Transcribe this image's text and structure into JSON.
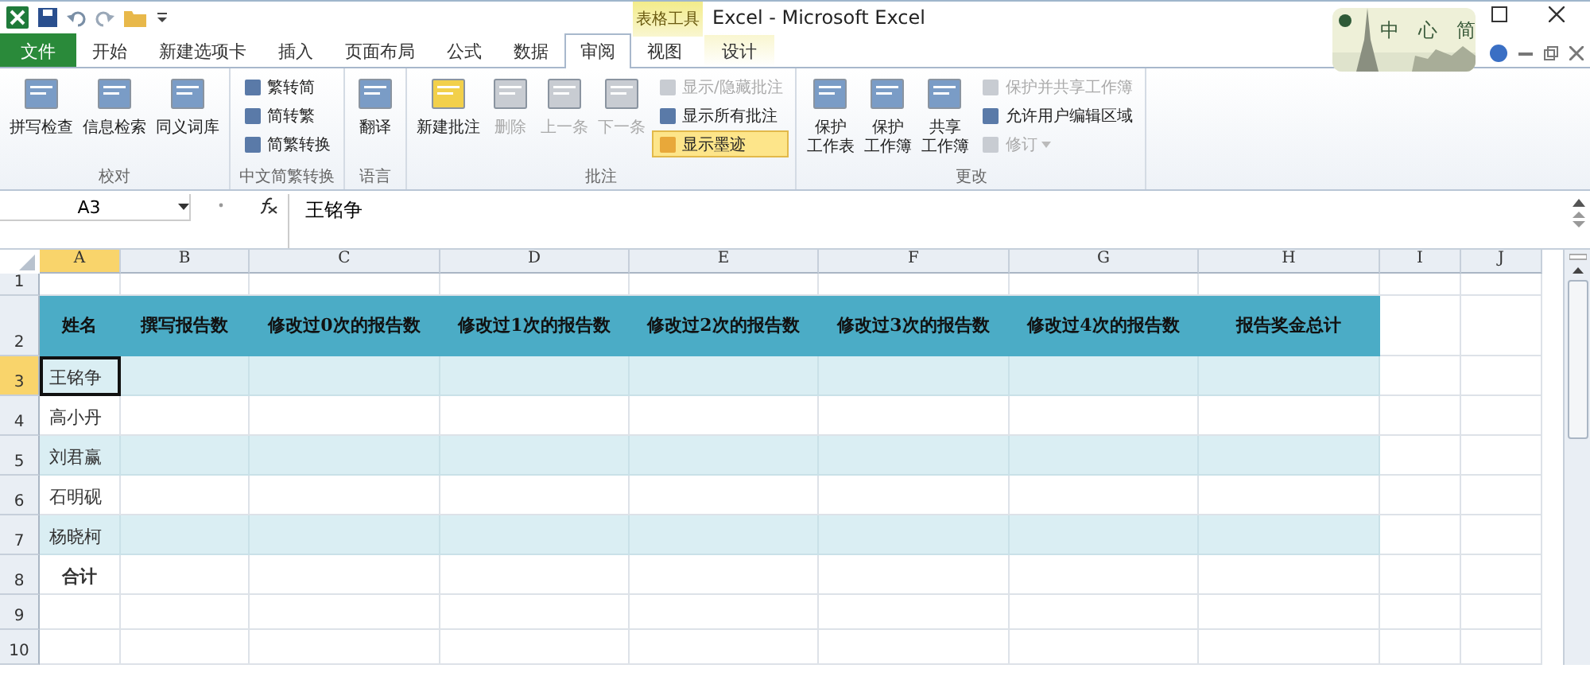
{
  "window": {
    "title": "Excel - Microsoft Excel",
    "contextual_group": "表格工具"
  },
  "tabs": [
    {
      "label": "文件",
      "kind": "file",
      "selected": false
    },
    {
      "label": "开始",
      "kind": "tab",
      "selected": false
    },
    {
      "label": "新建选项卡",
      "kind": "tab",
      "selected": false
    },
    {
      "label": "插入",
      "kind": "tab",
      "selected": false
    },
    {
      "label": "页面布局",
      "kind": "tab",
      "selected": false
    },
    {
      "label": "公式",
      "kind": "tab",
      "selected": false
    },
    {
      "label": "数据",
      "kind": "tab",
      "selected": false
    },
    {
      "label": "审阅",
      "kind": "tab",
      "selected": true
    },
    {
      "label": "视图",
      "kind": "tab",
      "selected": false
    },
    {
      "label": "设计",
      "kind": "contextual",
      "selected": false
    }
  ],
  "ime_bar": {
    "labels": [
      "中",
      "心",
      "简"
    ]
  },
  "ribbon_groups": [
    {
      "label": "校对",
      "items": [
        {
          "label": "拼写检查",
          "kind": "large",
          "disabled": false,
          "on": false
        },
        {
          "label": "信息检索",
          "kind": "large",
          "disabled": false,
          "on": false
        },
        {
          "label": "同义词库",
          "kind": "large",
          "disabled": false,
          "on": false
        }
      ]
    },
    {
      "label": "中文简繁转换",
      "items": [
        {
          "label": "繁转简",
          "kind": "small",
          "disabled": false,
          "on": false
        },
        {
          "label": "简转繁",
          "kind": "small",
          "disabled": false,
          "on": false
        },
        {
          "label": "简繁转换",
          "kind": "small",
          "disabled": false,
          "on": false
        }
      ]
    },
    {
      "label": "语言",
      "items": [
        {
          "label": "翻译",
          "kind": "large",
          "disabled": false,
          "on": false
        }
      ]
    },
    {
      "label": "批注",
      "items": [
        {
          "label": "新建批注",
          "kind": "large",
          "disabled": false,
          "on": false
        },
        {
          "label": "删除",
          "kind": "large",
          "disabled": true,
          "on": false
        },
        {
          "label": "上一条",
          "kind": "large",
          "disabled": true,
          "on": false
        },
        {
          "label": "下一条",
          "kind": "large",
          "disabled": true,
          "on": false
        },
        {
          "label": "显示/隐藏批注",
          "kind": "small",
          "disabled": true,
          "on": false
        },
        {
          "label": "显示所有批注",
          "kind": "small",
          "disabled": false,
          "on": false
        },
        {
          "label": "显示墨迹",
          "kind": "small",
          "disabled": false,
          "on": true
        }
      ]
    },
    {
      "label": "更改",
      "items": [
        {
          "label_lines": [
            "保护",
            "工作表"
          ],
          "kind": "large",
          "disabled": false,
          "on": false
        },
        {
          "label_lines": [
            "保护",
            "工作簿"
          ],
          "kind": "large",
          "disabled": false,
          "on": false
        },
        {
          "label_lines": [
            "共享",
            "工作簿"
          ],
          "kind": "large",
          "disabled": false,
          "on": false
        },
        {
          "label": "保护并共享工作簿",
          "kind": "small",
          "disabled": true,
          "on": false
        },
        {
          "label": "允许用户编辑区域",
          "kind": "small",
          "disabled": false,
          "on": false
        },
        {
          "label": "修订",
          "kind": "dropdown",
          "disabled": true,
          "on": false
        }
      ]
    }
  ],
  "formula_bar": {
    "name_box": "A3",
    "formula": "王铭争"
  },
  "sheet": {
    "columns": [
      {
        "label": "A",
        "selected": true
      },
      {
        "label": "B",
        "selected": false
      },
      {
        "label": "C",
        "selected": false
      },
      {
        "label": "D",
        "selected": false
      },
      {
        "label": "E",
        "selected": false
      },
      {
        "label": "F",
        "selected": false
      },
      {
        "label": "G",
        "selected": false
      },
      {
        "label": "H",
        "selected": false
      },
      {
        "label": "I",
        "selected": false
      },
      {
        "label": "J",
        "selected": false
      }
    ],
    "rows": [
      {
        "number": "1",
        "kind": "blank",
        "selected": false
      },
      {
        "number": "2",
        "kind": "header",
        "selected": false,
        "cells": [
          "姓名",
          "撰写报告数",
          "修改过0次的报告数",
          "修改过1次的报告数",
          "修改过2次的报告数",
          "修改过3次的报告数",
          "修改过4次的报告数",
          "报告奖金总计"
        ]
      },
      {
        "number": "3",
        "kind": "band",
        "selected": true,
        "cells": [
          "王铭争"
        ]
      },
      {
        "number": "4",
        "kind": "plain",
        "selected": false,
        "cells": [
          "高小丹"
        ]
      },
      {
        "number": "5",
        "kind": "band",
        "selected": false,
        "cells": [
          "刘君赢"
        ]
      },
      {
        "number": "6",
        "kind": "plain",
        "selected": false,
        "cells": [
          "石明砚"
        ]
      },
      {
        "number": "7",
        "kind": "band",
        "selected": false,
        "cells": [
          "杨晓柯"
        ]
      },
      {
        "number": "8",
        "kind": "total",
        "selected": false,
        "cells": [
          "合计"
        ]
      },
      {
        "number": "9",
        "kind": "blank",
        "selected": false
      },
      {
        "number": "10",
        "kind": "blank",
        "selected": false
      }
    ]
  }
}
